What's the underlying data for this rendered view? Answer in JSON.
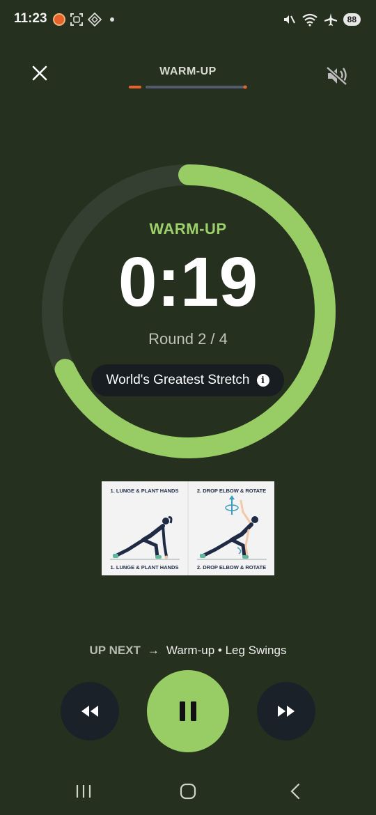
{
  "status_bar": {
    "time": "11:23",
    "battery": "88",
    "signal_label": "5"
  },
  "header": {
    "title": "WARM-UP",
    "progress": 0.25
  },
  "timer": {
    "phase": "WARM-UP",
    "time": "0:19",
    "round": "Round 2 / 4",
    "elapsed_fraction": 0.32
  },
  "exercise": {
    "name": "World's Greatest Stretch",
    "info_icon": "i"
  },
  "illustration": {
    "step1": "1. LUNGE & PLANT HANDS",
    "step2": "2. DROP ELBOW & ROTATE"
  },
  "up_next": {
    "label": "UP NEXT",
    "arrow": "→",
    "name": "Warm-up • Leg Swings"
  },
  "colors": {
    "accent": "#98cc64",
    "track": "#343e31",
    "background": "#26301f",
    "orange": "#e8632b"
  }
}
